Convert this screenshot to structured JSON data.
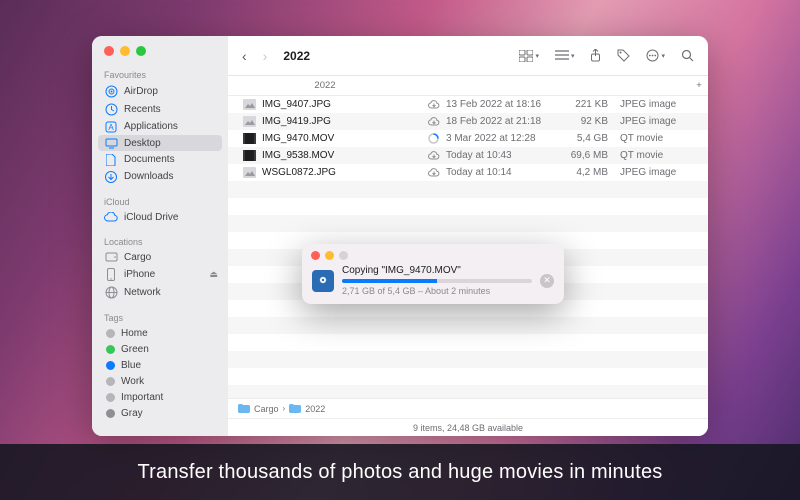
{
  "window": {
    "title": "2022"
  },
  "sidebar": {
    "sections": [
      {
        "header": "Favourites",
        "items": [
          {
            "label": "AirDrop",
            "icon": "airdrop"
          },
          {
            "label": "Recents",
            "icon": "clock"
          },
          {
            "label": "Applications",
            "icon": "app"
          },
          {
            "label": "Desktop",
            "icon": "desktop",
            "selected": true
          },
          {
            "label": "Documents",
            "icon": "doc"
          },
          {
            "label": "Downloads",
            "icon": "download"
          }
        ]
      },
      {
        "header": "iCloud",
        "items": [
          {
            "label": "iCloud Drive",
            "icon": "cloud"
          }
        ]
      },
      {
        "header": "Locations",
        "items": [
          {
            "label": "Cargo",
            "icon": "disk"
          },
          {
            "label": "iPhone",
            "icon": "phone",
            "eject": true
          },
          {
            "label": "Network",
            "icon": "network"
          }
        ]
      },
      {
        "header": "Tags",
        "items": [
          {
            "label": "Home",
            "tag": "#b6b6ba"
          },
          {
            "label": "Green",
            "tag": "#34c759"
          },
          {
            "label": "Blue",
            "tag": "#0a7aff"
          },
          {
            "label": "Work",
            "tag": "#b6b6ba"
          },
          {
            "label": "Important",
            "tag": "#b6b6ba"
          },
          {
            "label": "Gray",
            "tag": "#8e8e93"
          }
        ]
      }
    ]
  },
  "columns": {
    "name": "2022"
  },
  "files": [
    {
      "name": "IMG_9407.JPG",
      "cloud": "cloud",
      "date": "13 Feb 2022 at 18:16",
      "size": "221 KB",
      "kind": "JPEG image",
      "ficon": "jpg"
    },
    {
      "name": "IMG_9419.JPG",
      "cloud": "cloud",
      "date": "18 Feb 2022 at 21:18",
      "size": "92 KB",
      "kind": "JPEG image",
      "ficon": "jpg"
    },
    {
      "name": "IMG_9470.MOV",
      "cloud": "progress",
      "date": "3 Mar 2022 at 12:28",
      "size": "5,4 GB",
      "kind": "QT movie",
      "ficon": "mov"
    },
    {
      "name": "IMG_9538.MOV",
      "cloud": "cloud",
      "date": "Today at 10:43",
      "size": "69,6 MB",
      "kind": "QT movie",
      "ficon": "mov"
    },
    {
      "name": "WSGL0872.JPG",
      "cloud": "cloud",
      "date": "Today at 10:14",
      "size": "4,2 MB",
      "kind": "JPEG image",
      "ficon": "jpg"
    }
  ],
  "pathbar": {
    "seg1": "Cargo",
    "seg2": "2022"
  },
  "status": "9 items, 24,48 GB available",
  "copy": {
    "title": "Copying \"IMG_9470.MOV\"",
    "sub": "2,71 GB of 5,4 GB – About 2 minutes",
    "progress_pct": 50
  },
  "caption": "Transfer thousands of photos and huge movies in minutes"
}
